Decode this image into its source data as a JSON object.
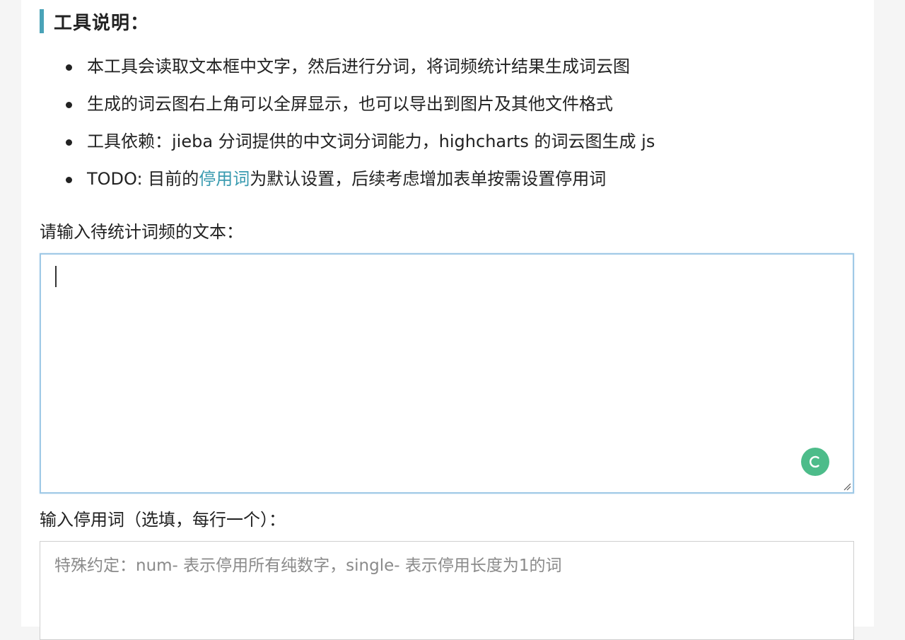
{
  "section": {
    "title": "工具说明："
  },
  "bullets": [
    {
      "text": "本工具会读取文本框中文字，然后进行分词，将词频统计结果生成词云图"
    },
    {
      "text": "生成的词云图右上角可以全屏显示，也可以导出到图片及其他文件格式"
    },
    {
      "text": "工具依赖：jieba 分词提供的中文词分词能力，highcharts 的词云图生成 js"
    },
    {
      "before": "TODO: 目前的",
      "link": "停用词",
      "after": "为默认设置，后续考虑增加表单按需设置停用词"
    }
  ],
  "text_input": {
    "label": "请输入待统计词频的文本：",
    "value": ""
  },
  "stopwords_input": {
    "label": "输入停用词（选填，每行一个）：",
    "placeholder": "特殊约定：num- 表示停用所有纯数字，single- 表示停用长度为1的词"
  },
  "colors": {
    "accent": "#4aa3b8",
    "link": "#3a9bb0",
    "grammar_icon": "#4dbc8a",
    "focus_border": "#9fc9e6"
  }
}
